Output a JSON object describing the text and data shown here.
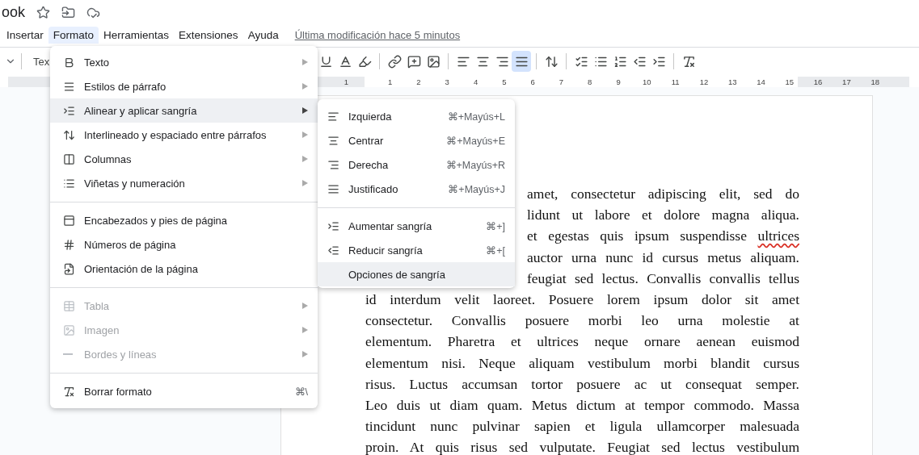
{
  "title": "ook",
  "menubar": [
    {
      "label": "Insertar",
      "selected": false
    },
    {
      "label": "Formato",
      "selected": true
    },
    {
      "label": "Herramientas",
      "selected": false
    },
    {
      "label": "Extensiones",
      "selected": false
    },
    {
      "label": "Ayuda",
      "selected": false
    }
  ],
  "last_modified": "Última modificación hace 5 minutos",
  "toolbar": {
    "style_dropdown": "Tex",
    "justify_selected": true
  },
  "ruler": {
    "numbers": [
      "1",
      "1",
      "2",
      "3",
      "4",
      "5",
      "6",
      "7",
      "8",
      "9",
      "10",
      "11",
      "12",
      "13",
      "14",
      "15",
      "16",
      "17",
      "18"
    ]
  },
  "format_menu": {
    "groups": [
      [
        {
          "label": "Texto",
          "submenu": true,
          "selected": false,
          "disabled": false
        },
        {
          "label": "Estilos de párrafo",
          "submenu": true,
          "selected": false,
          "disabled": false
        },
        {
          "label": "Alinear y aplicar sangría",
          "submenu": true,
          "selected": true,
          "disabled": false
        },
        {
          "label": "Interlineado y espaciado entre párrafos",
          "submenu": true,
          "selected": false,
          "disabled": false
        },
        {
          "label": "Columnas",
          "submenu": true,
          "selected": false,
          "disabled": false
        },
        {
          "label": "Viñetas y numeración",
          "submenu": true,
          "selected": false,
          "disabled": false
        }
      ],
      [
        {
          "label": "Encabezados y pies de página",
          "submenu": false,
          "selected": false,
          "disabled": false
        },
        {
          "label": "Números de página",
          "submenu": false,
          "selected": false,
          "disabled": false
        },
        {
          "label": "Orientación de la página",
          "submenu": false,
          "selected": false,
          "disabled": false
        }
      ],
      [
        {
          "label": "Tabla",
          "submenu": true,
          "selected": false,
          "disabled": true
        },
        {
          "label": "Imagen",
          "submenu": true,
          "selected": false,
          "disabled": true
        },
        {
          "label": "Bordes y líneas",
          "submenu": true,
          "selected": false,
          "disabled": true
        }
      ],
      [
        {
          "label": "Borrar formato",
          "submenu": false,
          "selected": false,
          "disabled": false,
          "shortcut": "⌘\\"
        }
      ]
    ]
  },
  "align_submenu": {
    "groups": [
      [
        {
          "label": "Izquierda",
          "shortcut": "⌘+Mayús+L",
          "selected": false
        },
        {
          "label": "Centrar",
          "shortcut": "⌘+Mayús+E",
          "selected": false
        },
        {
          "label": "Derecha",
          "shortcut": "⌘+Mayús+R",
          "selected": false
        },
        {
          "label": "Justificado",
          "shortcut": "⌘+Mayús+J",
          "selected": false
        }
      ],
      [
        {
          "label": "Aumentar sangría",
          "shortcut": "⌘+]",
          "selected": false
        },
        {
          "label": "Reducir sangría",
          "shortcut": "⌘+[",
          "selected": false
        },
        {
          "label": "Opciones de sangría",
          "selected": true
        }
      ]
    ]
  },
  "document": {
    "covered_lines": [
      {
        "text": "amet, consectetur adipiscing elit, sed do"
      },
      {
        "text": "lidunt ut labore et dolore magna aliqua."
      },
      {
        "text": "et egestas quis ipsum suspendisse",
        "spelling_error": "ultrices"
      },
      {
        "text": "auctor urna nunc id cursus metus aliquam."
      },
      {
        "text": "feugiat sed lectus. Convallis convallis tellus"
      }
    ],
    "lines": [
      "id interdum velit laoreet. Posuere lorem ipsum dolor sit amet",
      "consectetur. Convallis posuere morbi leo urna molestie at",
      "elementum. Pharetra et ultrices neque ornare aenean euismod",
      "elementum nisi. Neque aliquam vestibulum morbi blandit cursus",
      "risus. Luctus accumsan tortor posuere ac ut consequat semper.",
      "Leo duis ut diam quam. Metus dictum at tempor commodo. Massa",
      "tincidunt nunc pulvinar sapien et ligula ullamcorper malesuada",
      "proin. At quis risus sed vulputate. Feugiat sed lectus vestibulum"
    ]
  }
}
